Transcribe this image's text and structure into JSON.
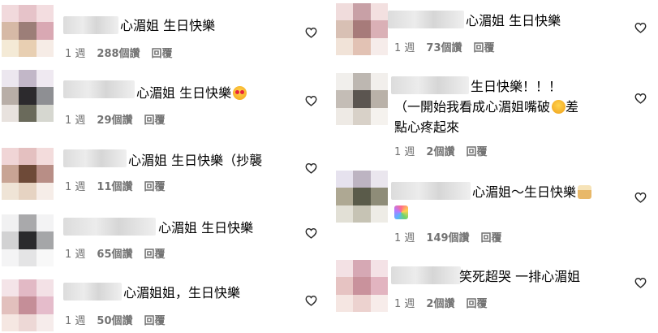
{
  "left_comments": [
    {
      "text": "心湄姐 生日快樂",
      "emoji": null,
      "time": "1 週",
      "likes": "288個讚",
      "reply": "回覆"
    },
    {
      "text": "心湄姐 生日快樂",
      "emoji": "heart-eyes",
      "time": "1 週",
      "likes": "29個讚",
      "reply": "回覆"
    },
    {
      "text": "心湄姐 生日快樂（抄襲",
      "emoji": null,
      "time": "1 週",
      "likes": "11個讚",
      "reply": "回覆"
    },
    {
      "text": "心湄姐 生日快樂",
      "emoji": null,
      "time": "1 週",
      "likes": "65個讚",
      "reply": "回覆"
    },
    {
      "text": "心湄姐姐，生日快樂",
      "emoji": null,
      "time": "1 週",
      "likes": "50個讚",
      "reply": "回覆"
    }
  ],
  "right_comments": [
    {
      "text": "心湄姐 生日快樂",
      "time": "1 週",
      "likes": "73個讚",
      "reply": "回覆"
    },
    {
      "line1": "生日快樂！！！",
      "line2": "（一開始我看成心湄姐嘴破",
      "line2_emoji": "pleading",
      "line2_tail": "差",
      "line3": "點心疼起來",
      "time": "1 週",
      "likes": "2個讚",
      "reply": "回覆"
    },
    {
      "text": "心湄姐～生日快樂",
      "emoji": "cake",
      "emoji2": "rainbow",
      "time": "1 週",
      "likes": "149個讚",
      "reply": "回覆"
    },
    {
      "text": "笑死超哭 一排心湄姐",
      "time": "1 週",
      "likes": "2個讚",
      "reply": "回覆"
    }
  ],
  "icons": {
    "like": "heart-outline-icon"
  }
}
